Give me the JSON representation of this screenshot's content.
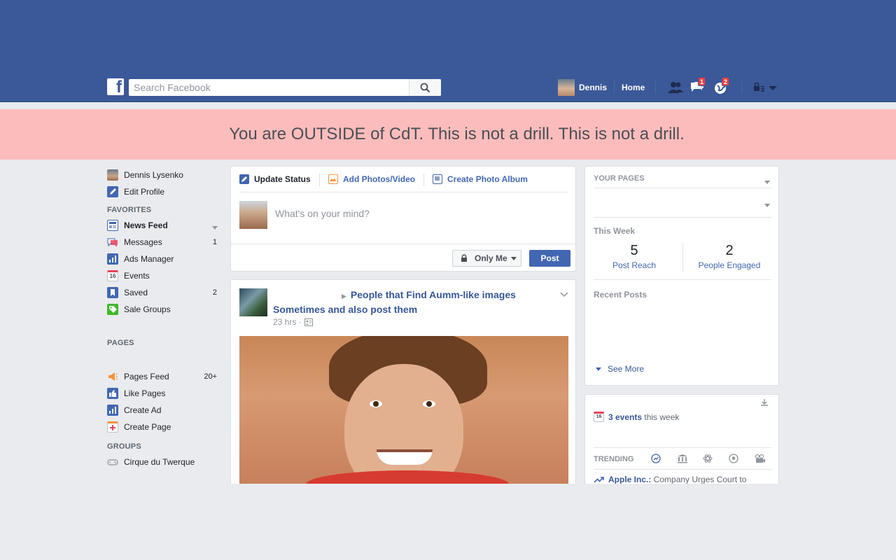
{
  "topbar": {
    "logo_letter": "f",
    "search_placeholder": "Search Facebook",
    "user_name": "Dennis",
    "home_label": "Home",
    "messages_badge": "1",
    "notifications_badge": "2",
    "brand_color": "#3b5998"
  },
  "banner": {
    "text": "You are OUTSIDE of CdT. This is not a drill. This is not a drill.",
    "background": "#fdbcbc"
  },
  "left_nav": {
    "profile_name": "Dennis Lysenko",
    "edit_profile": "Edit Profile",
    "favorites_header": "FAVORITES",
    "favorites": [
      {
        "label": "News Feed",
        "count": "",
        "icon": "news-feed-icon"
      },
      {
        "label": "Messages",
        "count": "1",
        "icon": "messages-icon"
      },
      {
        "label": "Ads Manager",
        "count": "",
        "icon": "ads-manager-icon"
      },
      {
        "label": "Events",
        "count": "",
        "icon": "events-icon"
      },
      {
        "label": "Saved",
        "count": "2",
        "icon": "saved-icon"
      },
      {
        "label": "Sale Groups",
        "count": "",
        "icon": "sale-groups-icon"
      }
    ],
    "pages_header": "PAGES",
    "pages": [
      {
        "label": "Pages Feed",
        "count": "20+",
        "icon": "pages-feed-icon"
      },
      {
        "label": "Like Pages",
        "count": "",
        "icon": "like-pages-icon"
      },
      {
        "label": "Create Ad",
        "count": "",
        "icon": "create-ad-icon"
      },
      {
        "label": "Create Page",
        "count": "",
        "icon": "create-page-icon"
      }
    ],
    "groups_header": "GROUPS",
    "groups": [
      {
        "label": "Cirque du Twerque",
        "icon": "group-icon"
      }
    ]
  },
  "composer": {
    "tab_update_status": "Update Status",
    "tab_add_photos": "Add Photos/Video",
    "tab_create_album": "Create Photo Album",
    "placeholder": "What's on your mind?",
    "privacy_label": "Only Me",
    "post_label": "Post"
  },
  "feed_post": {
    "title": "People that Find Aumm-like images Sometimes and also post them",
    "time": "23 hrs ·"
  },
  "your_pages": {
    "header": "YOUR PAGES",
    "this_week": "This Week",
    "post_reach_value": "5",
    "post_reach_label": "Post Reach",
    "engaged_value": "2",
    "engaged_label": "People Engaged",
    "recent_posts": "Recent Posts",
    "see_more": "See More"
  },
  "events": {
    "calendar_day": "16",
    "events_count": "3 events",
    "events_suffix": " this week",
    "trending_header": "TRENDING",
    "trending_topic": "Apple Inc.:",
    "trending_text": " Company Urges Court to"
  }
}
